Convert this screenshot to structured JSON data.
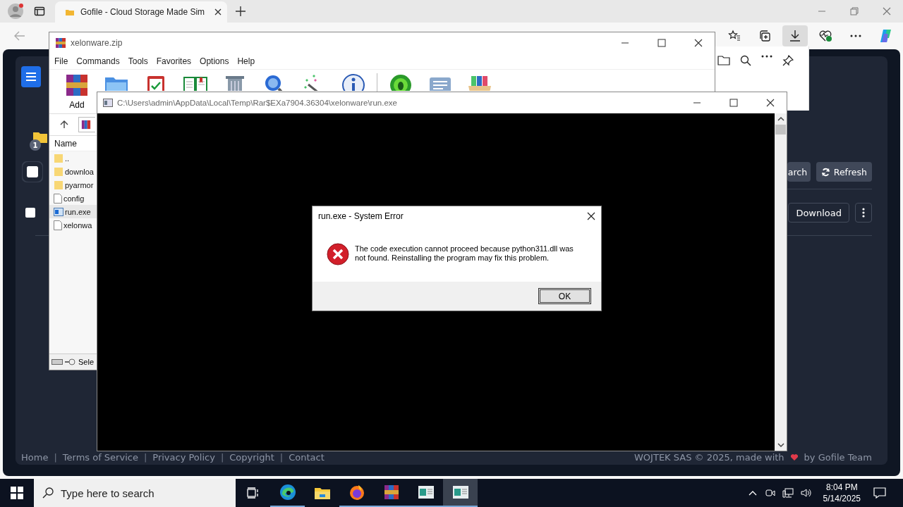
{
  "browser": {
    "tabs": [
      {
        "title": "Gofile - Cloud Storage Made Sim",
        "selected": true
      }
    ],
    "toolbar_buttons": [
      {
        "kind": "favorites",
        "selected": false
      },
      {
        "kind": "collections",
        "selected": false
      },
      {
        "kind": "downloads",
        "selected": true
      },
      {
        "kind": "health",
        "selected": false
      },
      {
        "kind": "more",
        "selected": false
      },
      {
        "kind": "copilot",
        "selected": false
      }
    ],
    "downloads_panel": {
      "buttons": [
        {
          "kind": "folder"
        },
        {
          "kind": "search"
        },
        {
          "kind": "more"
        },
        {
          "kind": "pin"
        }
      ]
    },
    "page": {
      "folder_badge": "1",
      "select_all": {
        "checked": false
      },
      "file_checkbox": {
        "checked": false
      },
      "toolbar_buttons": [
        {
          "kind": "search",
          "label": "arch"
        },
        {
          "kind": "refresh",
          "label": "Refresh"
        }
      ],
      "download_label": "Download",
      "footer": [
        {
          "kind": "link",
          "text": "Home"
        },
        {
          "kind": "separator",
          "text": "|"
        },
        {
          "kind": "link",
          "text": "Terms of Service"
        },
        {
          "kind": "separator",
          "text": "|"
        },
        {
          "kind": "link",
          "text": "Privacy Policy"
        },
        {
          "kind": "separator",
          "text": "|"
        },
        {
          "kind": "link",
          "text": "Copyright"
        },
        {
          "kind": "separator",
          "text": "|"
        },
        {
          "kind": "link",
          "text": "Contact"
        }
      ],
      "credit_before": "WOJTEK SAS © 2025, made with",
      "credit_after": "by Gofile Team"
    }
  },
  "winrar": {
    "title": "xelonware.zip",
    "menu": [
      "File",
      "Commands",
      "Tools",
      "Favorites",
      "Options",
      "Help"
    ],
    "toolbar": [
      {
        "kind": "add",
        "label": "Add"
      },
      {
        "kind": "extract"
      },
      {
        "kind": "test"
      },
      {
        "kind": "view"
      },
      {
        "kind": "delete"
      },
      {
        "kind": "find"
      },
      {
        "kind": "wizard"
      },
      {
        "kind": "info"
      },
      {
        "kind": "virus"
      },
      {
        "kind": "comment"
      },
      {
        "kind": "sfx"
      }
    ],
    "column": "Name",
    "files": [
      {
        "name": "..",
        "kind": "folder",
        "selected": false
      },
      {
        "name": "downloa",
        "kind": "folder",
        "selected": false
      },
      {
        "name": "pyarmor",
        "kind": "folder",
        "selected": false
      },
      {
        "name": "config",
        "kind": "file",
        "selected": false
      },
      {
        "name": "run.exe",
        "kind": "exe",
        "selected": true
      },
      {
        "name": "xelonwa",
        "kind": "file",
        "selected": false
      }
    ],
    "status": "Sele"
  },
  "console": {
    "title": "C:\\Users\\admin\\AppData\\Local\\Temp\\Rar$EXa7904.36304\\xelonware\\run.exe"
  },
  "dialog": {
    "title": "run.exe - System Error",
    "message": "The code execution cannot proceed because python311.dll was not found. Reinstalling the program may fix this problem.",
    "ok": "OK"
  },
  "taskbar": {
    "search_placeholder": "Type here to search",
    "apps": [
      {
        "kind": "taskview",
        "running": false,
        "selected": false
      },
      {
        "kind": "edge",
        "running": true,
        "selected": false
      },
      {
        "kind": "explorer",
        "running": false,
        "selected": false
      },
      {
        "kind": "firefox",
        "running": true,
        "selected": false
      },
      {
        "kind": "winrar",
        "running": true,
        "selected": false
      },
      {
        "kind": "window",
        "running": true,
        "selected": false
      },
      {
        "kind": "window",
        "running": true,
        "selected": true
      }
    ],
    "time": "8:04 PM",
    "date": "5/14/2025"
  }
}
